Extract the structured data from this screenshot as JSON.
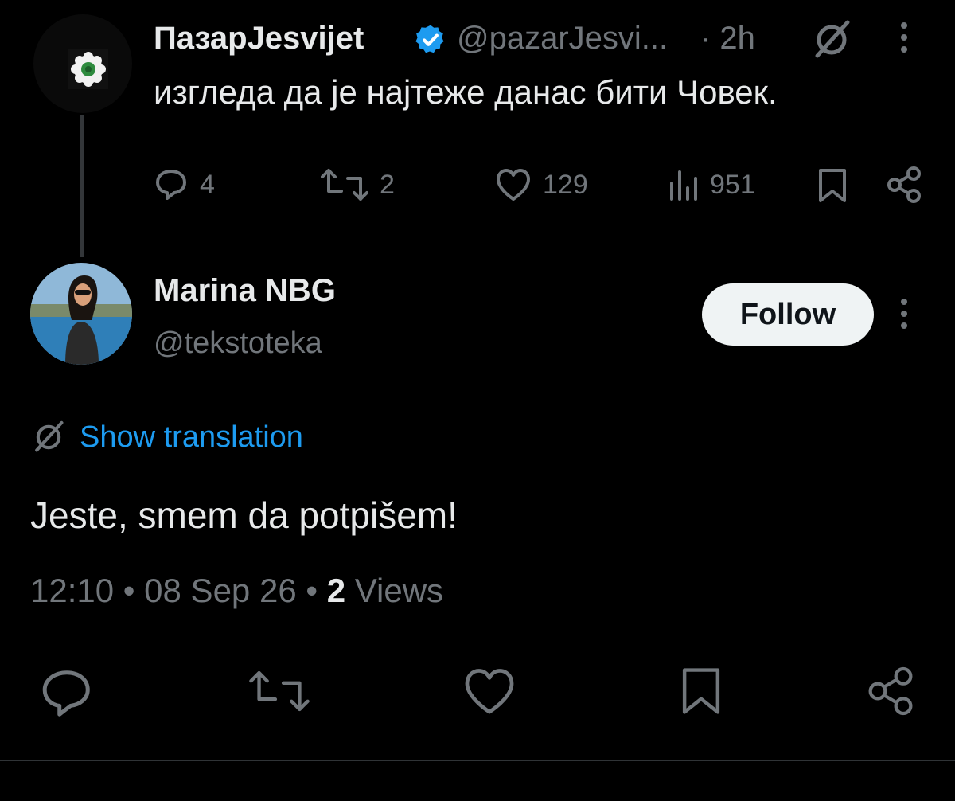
{
  "parent_tweet": {
    "display_name": "ПазарJesvijet",
    "handle": "@pazarJesvi...",
    "time": "· 2h",
    "text": "изгледа да је најтеже данас бити Човек.",
    "actions": {
      "replies": "4",
      "reposts": "2",
      "likes": "129",
      "views": "951"
    }
  },
  "reply_tweet": {
    "display_name": "Marina NBG",
    "handle": "@tekstoteka",
    "follow_label": "Follow",
    "show_translation": "Show translation",
    "text": "Jeste, smem da potpišem!",
    "meta": {
      "time": "12:10",
      "separator1": "•",
      "date": "08 Sep 26",
      "separator2": "•",
      "views_count": "2",
      "views_label": "Views"
    }
  },
  "colors": {
    "background": "#000000",
    "text_primary": "#e7e9ea",
    "text_secondary": "#71767b",
    "accent": "#1d9bf0",
    "follow_button_bg": "#eff3f4"
  },
  "icons": [
    "verified-badge-icon",
    "translate-icon",
    "more-icon",
    "reply-icon",
    "repost-icon",
    "like-icon",
    "views-icon",
    "bookmark-icon",
    "share-icon"
  ]
}
